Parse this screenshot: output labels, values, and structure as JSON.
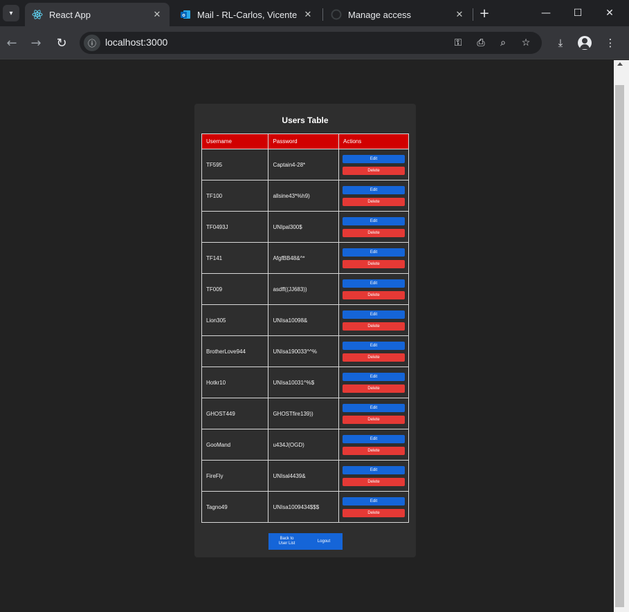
{
  "browser": {
    "tabs": [
      {
        "title": "React App",
        "active": true,
        "icon": "react-icon"
      },
      {
        "title": "Mail - RL-Carlos, Vicente (R",
        "active": false,
        "icon": "outlook-icon"
      },
      {
        "title": "Manage access",
        "active": false,
        "icon": "github-icon"
      }
    ],
    "url": "localhost:3000"
  },
  "page": {
    "title": "Users Table",
    "columns": [
      "Username",
      "Password",
      "Actions"
    ],
    "edit_label": "Edit",
    "delete_label": "Delete",
    "rows": [
      {
        "username": "TF595",
        "password": "Captain4-28*"
      },
      {
        "username": "TF100",
        "password": "allsine43*%h9)"
      },
      {
        "username": "TF0493J",
        "password": "UNIpal300$"
      },
      {
        "username": "TF141",
        "password": "AfgfBB48&^*"
      },
      {
        "username": "TF009",
        "password": "asdff((JJ683))"
      },
      {
        "username": "Lion305",
        "password": "UNIsa10098&"
      },
      {
        "username": "BrotherLove944",
        "password": "UNIsa190033^^%"
      },
      {
        "username": "Hotkr10",
        "password": "UNIsa10031^%$"
      },
      {
        "username": "GHOST449",
        "password": "GHOSTfire139))"
      },
      {
        "username": "GooMand",
        "password": "u434J(OGD)"
      },
      {
        "username": "FireFly",
        "password": "UNIsal4439&"
      },
      {
        "username": "Tagno49",
        "password": "UNIsa1009434$$$"
      }
    ],
    "back_button_line1": "Back to",
    "back_button_line2": "User List",
    "logout_label": "Logout"
  },
  "colors": {
    "header_red": "#d10000",
    "edit_blue": "#1565d8",
    "delete_red": "#e53935",
    "card_bg": "#2e2e2e",
    "page_bg": "#222222"
  }
}
